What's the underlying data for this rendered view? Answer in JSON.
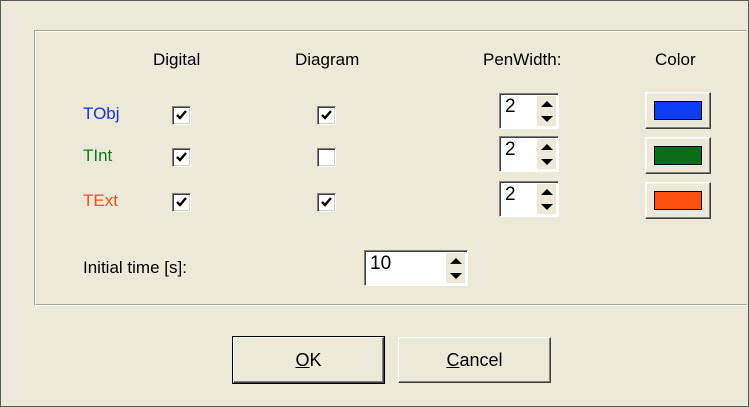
{
  "headers": {
    "digital": "Digital",
    "diagram": "Diagram",
    "pen_width": "PenWidth:",
    "color": "Color"
  },
  "signals": [
    {
      "name": "TObj",
      "label_color": "#1a2fe0",
      "digital": true,
      "diagram": true,
      "pen_width": "2",
      "color": "#0a3ef4"
    },
    {
      "name": "TInt",
      "label_color": "#0e7a17",
      "digital": true,
      "diagram": false,
      "pen_width": "2",
      "color": "#0a6d17"
    },
    {
      "name": "TExt",
      "label_color": "#f0501e",
      "digital": true,
      "diagram": true,
      "pen_width": "2",
      "color": "#fb4f0f"
    }
  ],
  "initial_time": {
    "label": "Initial time [s]:",
    "value": "10"
  },
  "buttons": {
    "ok": {
      "underlined": "O",
      "rest": "K"
    },
    "cancel": {
      "underlined": "C",
      "rest": "ancel"
    }
  }
}
